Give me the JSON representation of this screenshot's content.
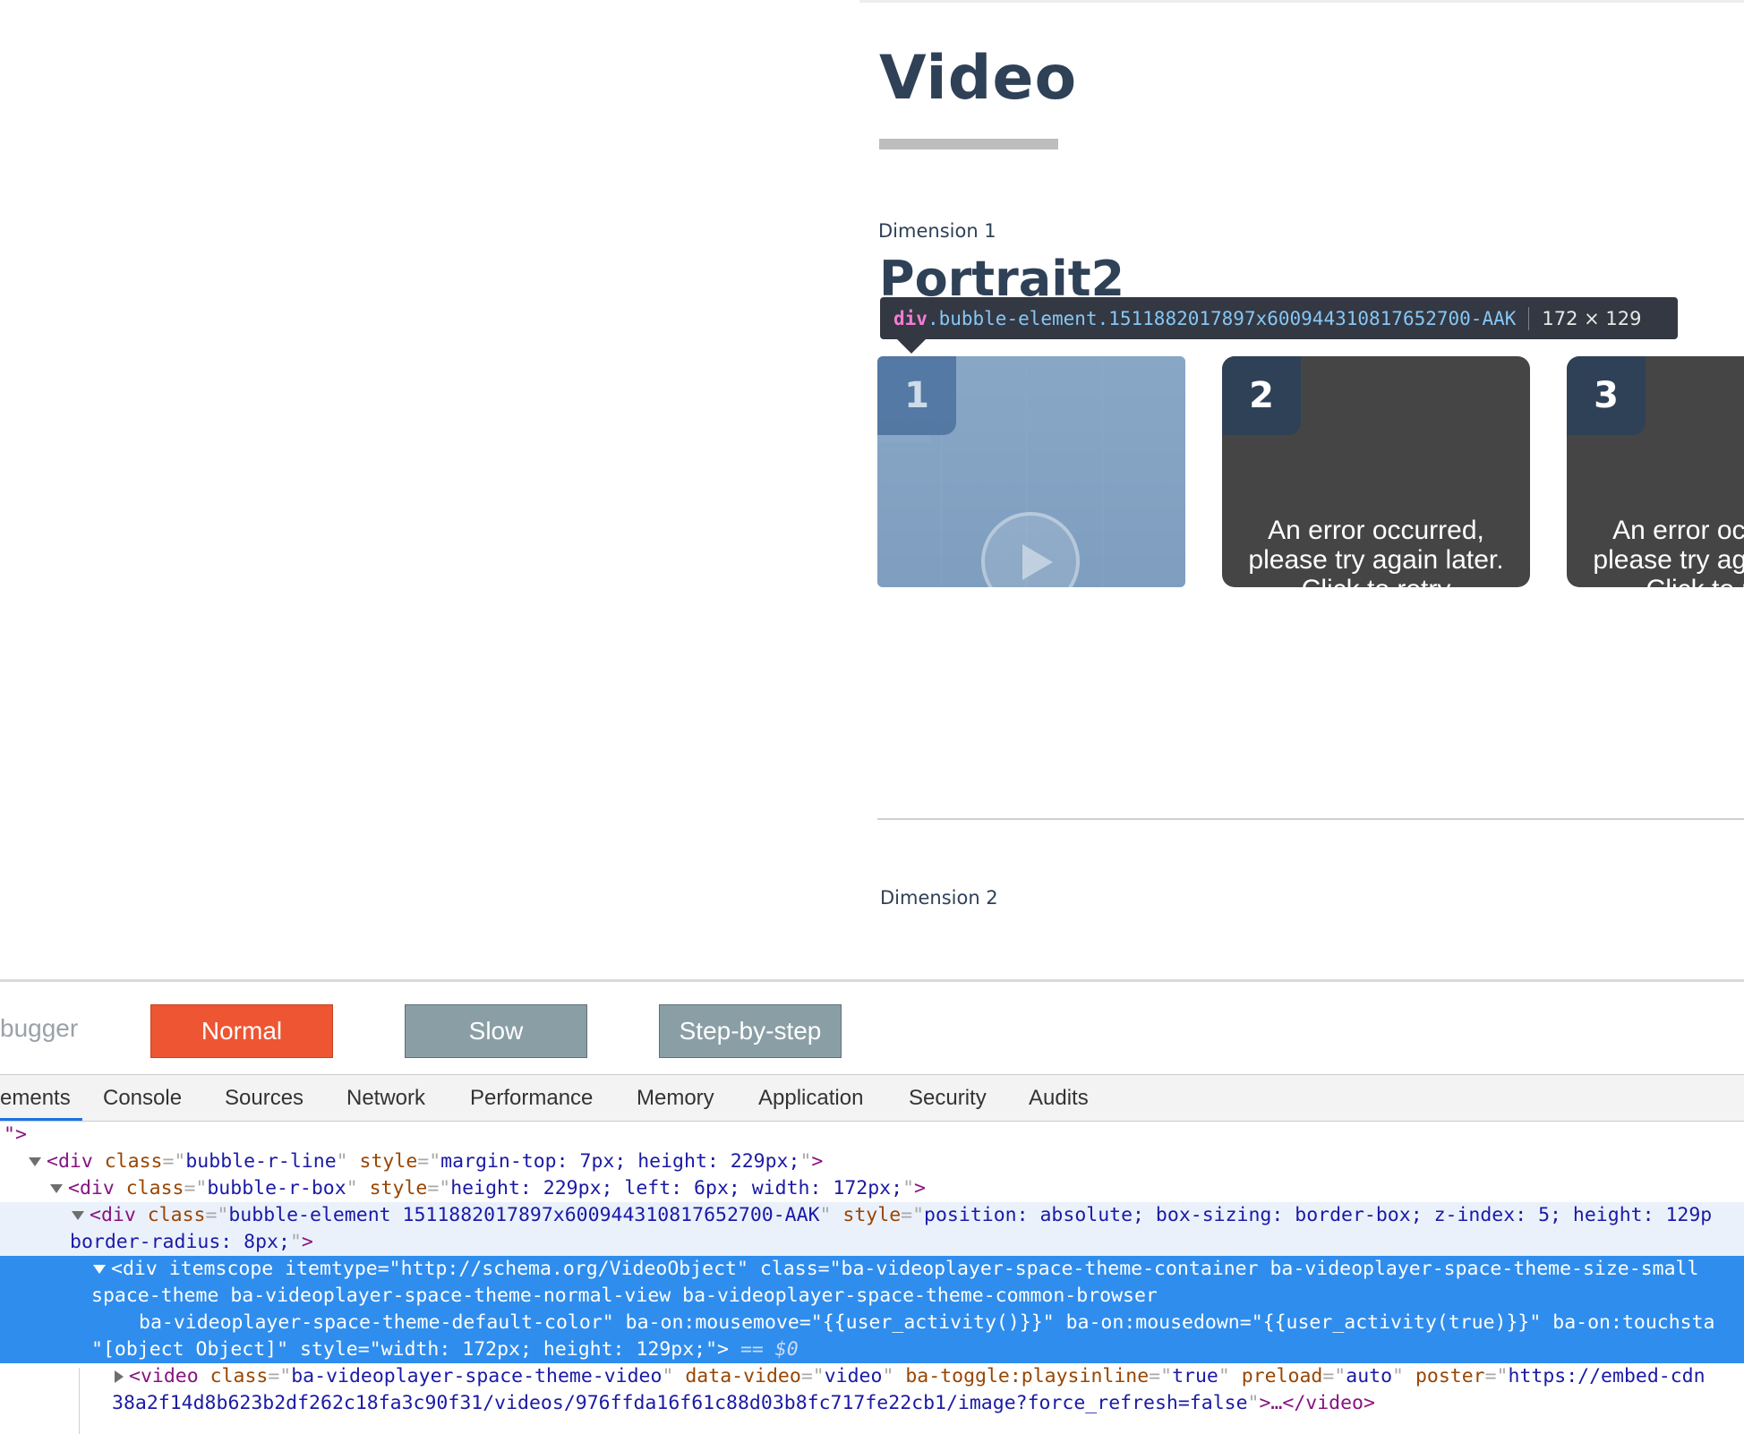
{
  "page": {
    "title": "Video",
    "dimension1_label": "Dimension 1",
    "section_title": "Portrait2",
    "dimension2_label": "Dimension 2"
  },
  "tooltip": {
    "tag": "div",
    "class_name": ".bubble-element.1511882017897x600944310817652700-AAK",
    "size": "172 × 129"
  },
  "bubbles": [
    {
      "number": "1",
      "message": ""
    },
    {
      "number": "2",
      "message_line1": "An error occurred,",
      "message_line2": "please try again later.",
      "message_line3": "Click to retry"
    },
    {
      "number": "3",
      "message_line1": "An error occurred,",
      "message_line2": "please try again later.",
      "message_line3": "Click to retry"
    }
  ],
  "debugger": {
    "label": "bugger",
    "buttons": [
      "Normal",
      "Slow",
      "Step-by-step"
    ]
  },
  "devtools": {
    "tabs": [
      "ements",
      "Console",
      "Sources",
      "Network",
      "Performance",
      "Memory",
      "Application",
      "Security",
      "Audits"
    ],
    "active_tab": "ements",
    "lines": {
      "l0": "\">",
      "l1_class": "bubble-r-line",
      "l1_style": "margin-top: 7px; height: 229px;",
      "l2_class": "bubble-r-box",
      "l2_style": "height: 229px; left: 6px; width: 172px;",
      "l3_class": "bubble-element 1511882017897x600944310817652700-AAK",
      "l3_style": "position: absolute; box-sizing: border-box; z-index: 5; height: 129p",
      "l4": "border-radius: 8px;",
      "l5_itemtype": "http://schema.org/VideoObject",
      "l5_class": "ba-videoplayer-space-theme-container ba-videoplayer-space-theme-size-small",
      "l6": "space-theme ba-videoplayer-space-theme-normal-view ba-videoplayer-space-theme-common-browser",
      "l7_class_end": "ba-videoplayer-space-theme-default-color",
      "l7_mousemove": "{{user_activity()}}",
      "l7_mousedown": "{{user_activity(true)}}",
      "l7_rest": "ba-on:touchsta",
      "l8_value": "[object Object]",
      "l8_style": "width: 172px; height: 129px;",
      "l8_ref": "== $0",
      "l9_class": "ba-videoplayer-space-theme-video",
      "l9_datavideo": "video",
      "l9_playsinline": "true",
      "l9_preload": "auto",
      "l9_poster": "https://embed-cdn",
      "l10": "38a2f14d8b623b2df262c18fa3c90f31/videos/976ffda16f61c88d03b8fc717fe22cb1/image?force_refresh=false"
    }
  }
}
